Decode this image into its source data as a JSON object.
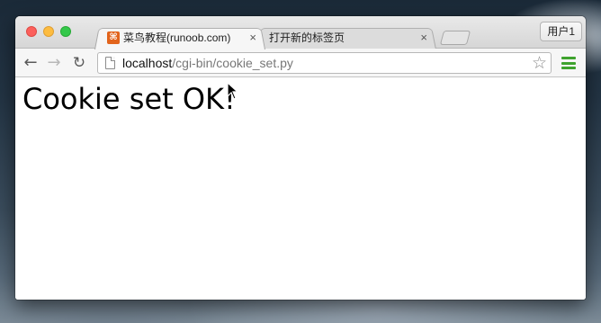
{
  "browser": {
    "tabs": [
      {
        "favicon": "runoob-favicon-icon",
        "favicon_glyph": "⌘",
        "title": "菜鸟教程(runoob.com)",
        "close": "×",
        "active": true
      },
      {
        "title": "打开新的标签页",
        "close": "×",
        "active": false
      }
    ],
    "user_button": "用户1",
    "toolbar": {
      "back_icon": "←",
      "forward_icon": "→",
      "reload_icon": "↻",
      "url_host": "localhost",
      "url_path": "/cgi-bin/cookie_set.py",
      "star_icon": "☆"
    }
  },
  "page": {
    "text": "Cookie set OK!"
  },
  "colors": {
    "close": "#fc605c",
    "minimize": "#fdbc40",
    "maximize": "#34c84a",
    "favicon": "#e2641c",
    "menu": "#3fa32e"
  }
}
